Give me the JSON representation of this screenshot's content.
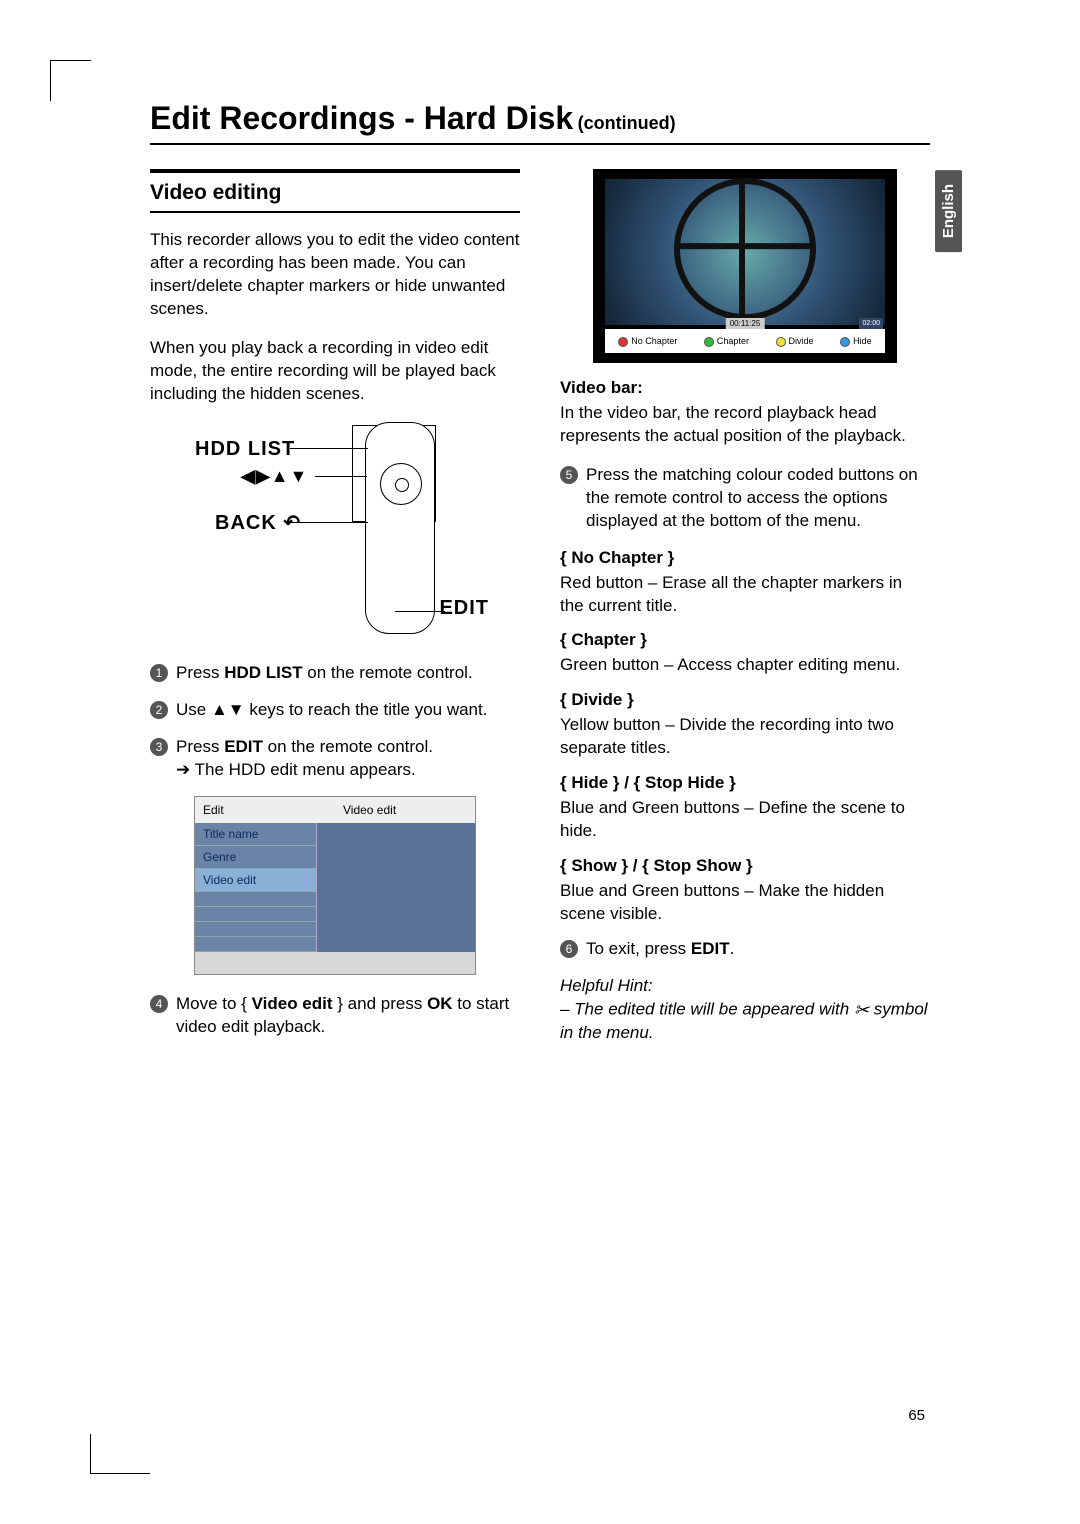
{
  "language_tab": "English",
  "page_number": "65",
  "title": "Edit Recordings - Hard Disk",
  "continued": "(continued)",
  "section": "Video editing",
  "intro1": "This recorder allows you to edit the video content after a recording has been made. You can insert/delete chapter markers or hide unwanted scenes.",
  "intro2": "When you play back a recording in video edit mode, the entire recording will be played back including the hidden scenes.",
  "remote": {
    "hdd": "HDD LIST",
    "arrows": "◀▶▲▼",
    "back": "BACK ↶",
    "edit": "EDIT"
  },
  "steps": {
    "s1a": "Press ",
    "s1b": "HDD LIST",
    "s1c": " on the remote control.",
    "s2a": "Use ▲▼ keys to reach the title you want.",
    "s3a": "Press ",
    "s3b": "EDIT",
    "s3c": " on the remote control.",
    "s3sub": "➔ The HDD edit menu appears.",
    "s4a": "Move to { ",
    "s4b": "Video edit",
    "s4c": " } and press ",
    "s4d": "OK",
    "s4e": " to start video edit playback.",
    "s5": "Press the matching colour coded buttons on the remote control to access the options displayed at the bottom of the menu.",
    "s6a": "To exit, press ",
    "s6b": "EDIT",
    "s6c": "."
  },
  "menu": {
    "head_left": "Edit",
    "head_right": "Video edit",
    "items": [
      "Title name",
      "Genre",
      "Video edit"
    ]
  },
  "video_shot": {
    "timecode": "00:11:25",
    "end": "02:00",
    "bar": {
      "nochapter": "No Chapter",
      "chapter": "Chapter",
      "divide": "Divide",
      "hide": "Hide"
    }
  },
  "video_bar": {
    "head": "Video bar:",
    "body": "In the video bar, the record playback head represents the actual position of the playback."
  },
  "options": {
    "nochapter": {
      "title": "{ No Chapter }",
      "body": "Red button – Erase all the chapter markers in the current title."
    },
    "chapter": {
      "title": "{ Chapter }",
      "body": "Green button – Access chapter editing menu."
    },
    "divide": {
      "title": "{ Divide }",
      "body": "Yellow button – Divide the recording into two separate titles."
    },
    "hide": {
      "title": "{ Hide } / { Stop Hide }",
      "body": "Blue and Green buttons – Define the scene to hide."
    },
    "show": {
      "title": "{ Show } / { Stop Show }",
      "body": "Blue and Green buttons – Make the hidden scene visible."
    }
  },
  "hint": {
    "head": "Helpful Hint:",
    "body_a": "– The edited title will be appeared with ",
    "body_b": " symbol in the menu."
  }
}
